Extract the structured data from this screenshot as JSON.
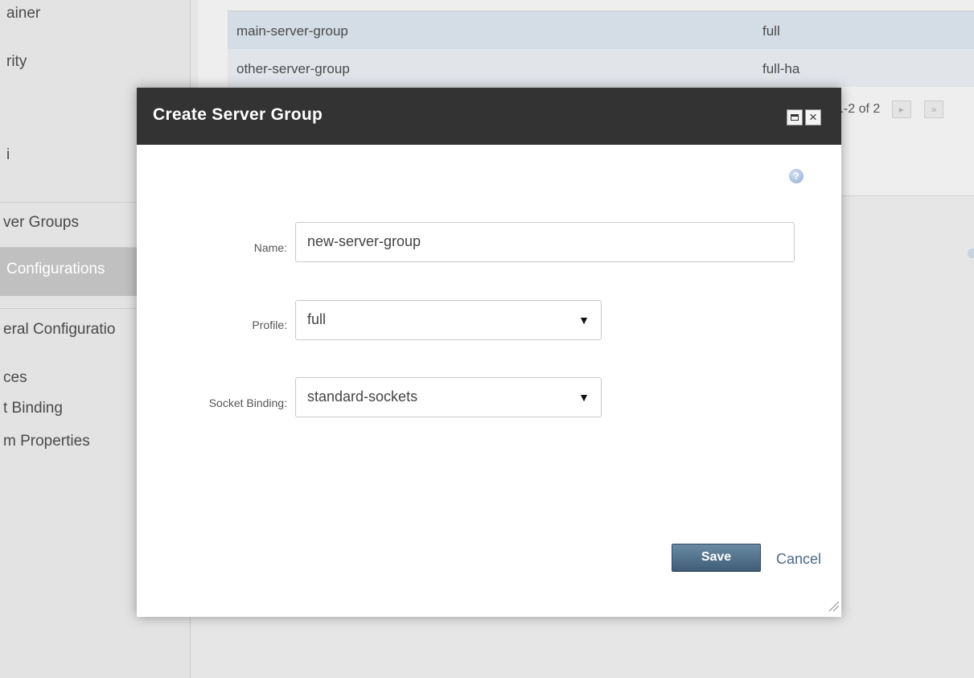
{
  "sidebar": {
    "items": [
      {
        "label": "ainer"
      },
      {
        "label": "rity"
      },
      {
        "label": "i"
      },
      {
        "label": "ver Groups"
      },
      {
        "label": " Configurations"
      },
      {
        "label": "eral Configuratio"
      },
      {
        "label": "ces"
      },
      {
        "label": "t Binding"
      },
      {
        "label": "m Properties"
      }
    ]
  },
  "table": {
    "rows": [
      {
        "name": "main-server-group",
        "profile": "full"
      },
      {
        "name": "other-server-group",
        "profile": "full-ha"
      }
    ],
    "pager_text": "..-2 of 2",
    "next_icon": "next-icon",
    "last_icon": "last-page-icon"
  },
  "dialog": {
    "title": "Create Server Group",
    "maximize_icon": "maximize-icon",
    "close_icon": "close-icon",
    "help_icon": "help-icon",
    "fields": {
      "name_label": "Name:",
      "name_value": "new-server-group",
      "profile_label": "Profile:",
      "profile_value": "full",
      "socket_label": "Socket Binding:",
      "socket_value": "standard-sockets"
    },
    "save_label": "Save",
    "cancel_label": "Cancel"
  }
}
